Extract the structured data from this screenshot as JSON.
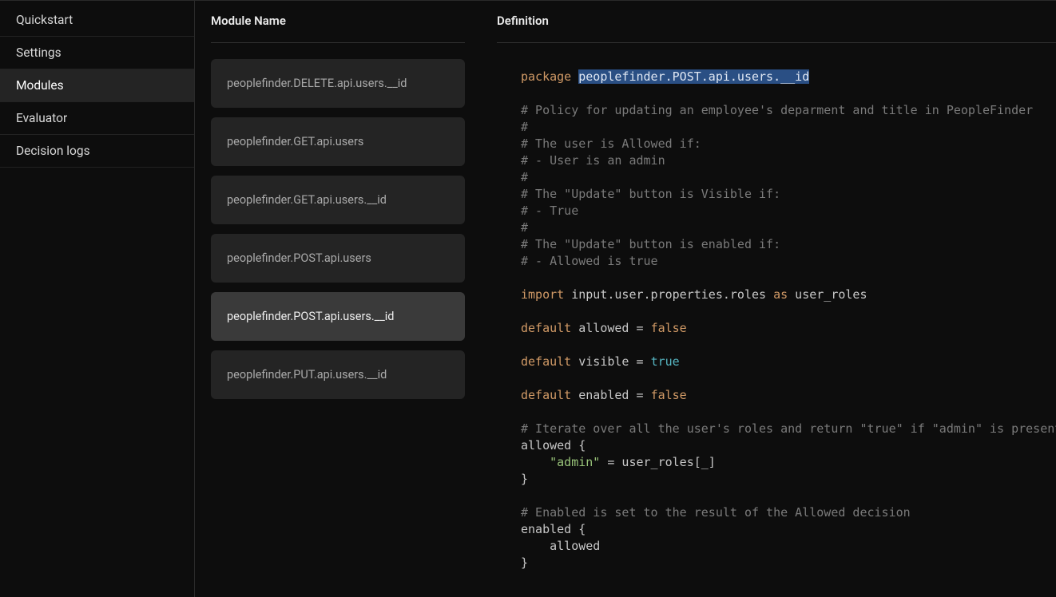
{
  "sidebar": {
    "items": [
      {
        "label": "Quickstart",
        "active": false
      },
      {
        "label": "Settings",
        "active": false
      },
      {
        "label": "Modules",
        "active": true
      },
      {
        "label": "Evaluator",
        "active": false
      },
      {
        "label": "Decision logs",
        "active": false
      }
    ]
  },
  "columns": {
    "module_header": "Module Name",
    "definition_header": "Definition"
  },
  "modules": [
    {
      "name": "peoplefinder.DELETE.api.users.__id",
      "selected": false
    },
    {
      "name": "peoplefinder.GET.api.users",
      "selected": false
    },
    {
      "name": "peoplefinder.GET.api.users.__id",
      "selected": false
    },
    {
      "name": "peoplefinder.POST.api.users",
      "selected": false
    },
    {
      "name": "peoplefinder.POST.api.users.__id",
      "selected": true
    },
    {
      "name": "peoplefinder.PUT.api.users.__id",
      "selected": false
    }
  ],
  "definition": {
    "package_kw": "package",
    "package_name": "peoplefinder.POST.api.users.__id",
    "comment_block": [
      "# Policy for updating an employee's deparment and title in PeopleFinder",
      "#",
      "# The user is Allowed if:",
      "# - User is an admin",
      "#",
      "# The \"Update\" button is Visible if:",
      "# - True",
      "#",
      "# The \"Update\" button is enabled if:",
      "# - Allowed is true"
    ],
    "import_kw": "import",
    "import_path": " input.user.properties.roles ",
    "as_kw": "as",
    "import_alias": " user_roles",
    "default_kw": "default",
    "default_allowed_lhs": " allowed = ",
    "default_visible_lhs": " visible = ",
    "default_enabled_lhs": " enabled = ",
    "false_tok": "false",
    "true_tok": "true",
    "iter_comment": "# Iterate over all the user's roles and return \"true\" if \"admin\" is present",
    "allowed_open": "allowed {",
    "allowed_body_indent": "    ",
    "admin_str": "\"admin\"",
    "allowed_body_rest": " = user_roles[_]",
    "close_brace": "}",
    "enabled_comment": "# Enabled is set to the result of the Allowed decision",
    "enabled_open": "enabled {",
    "enabled_body": "    allowed"
  }
}
